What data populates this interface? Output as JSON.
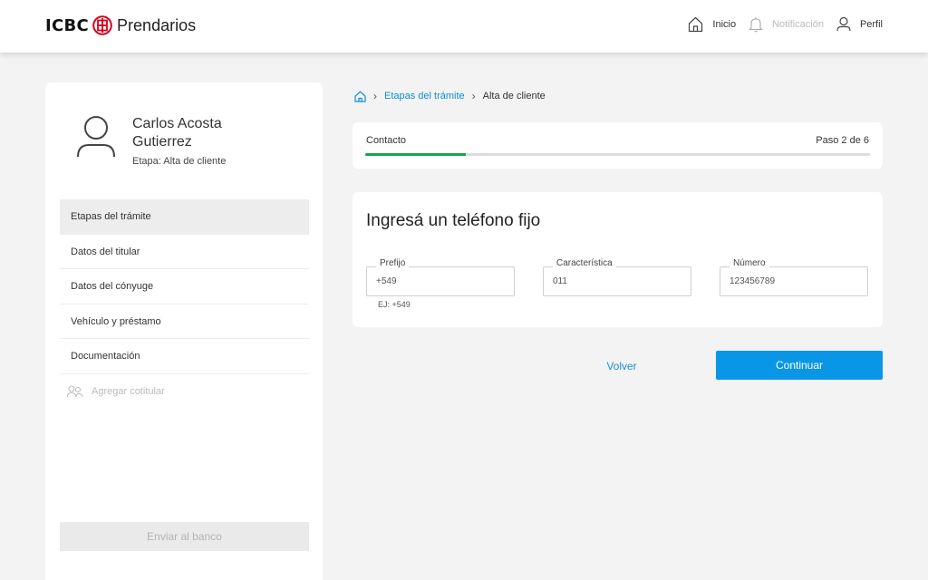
{
  "header": {
    "brand_prefix": "ICBC",
    "brand_name": "Prendarios",
    "nav": [
      {
        "label": "Inicio",
        "icon": "home-icon"
      },
      {
        "label": "Notificación",
        "icon": "bell-icon"
      },
      {
        "label": "Perfil",
        "icon": "user-icon"
      }
    ]
  },
  "sidebar": {
    "user_name": "Carlos Acosta Gutierrez",
    "stage": "Etapa: Alta de cliente",
    "items": [
      {
        "label": "Etapas del trámite"
      },
      {
        "label": "Datos del titular"
      },
      {
        "label": "Datos del cónyuge"
      },
      {
        "label": "Vehículo y préstamo"
      },
      {
        "label": "Documentación"
      },
      {
        "label": "Agregar cotitular"
      }
    ],
    "send_button": "Enviar al banco"
  },
  "breadcrumb": {
    "link": "Etapas del trámite",
    "current": "Alta de cliente"
  },
  "progress": {
    "label": "Contacto",
    "step_text": "Paso 2 de 6",
    "fraction": 0.2
  },
  "form": {
    "title": "Ingresá un teléfono fijo",
    "fields": [
      {
        "label": "Prefijo",
        "value": "+549",
        "help": "EJ: +549"
      },
      {
        "label": "Característica",
        "value": "011"
      },
      {
        "label": "Número",
        "value": "123456789"
      }
    ]
  },
  "actions": {
    "back": "Volver",
    "continue": "Continuar"
  },
  "colors": {
    "accent": "#0a96e6",
    "link": "#1a8fd8",
    "brand_red": "#d6001c",
    "progress": "#17a34a"
  }
}
